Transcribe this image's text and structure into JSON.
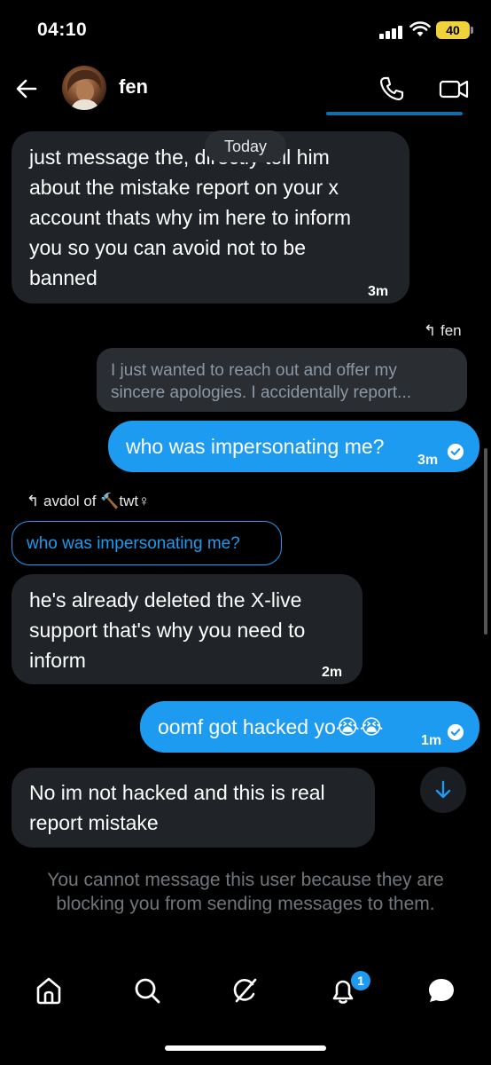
{
  "status_bar": {
    "time": "04:10",
    "battery": "40"
  },
  "header": {
    "contact_name": "fen",
    "back_icon": "arrow-left-icon",
    "call_icon": "phone-icon",
    "video_icon": "video-camera-icon"
  },
  "date_divider": "Today",
  "messages": [
    {
      "direction": "in",
      "lines": [
        "just message the, directly tell him",
        "about the mistake report on your x",
        "account thats why im here to inform",
        "you so you can avoid not to be",
        "banned"
      ],
      "time": "3m"
    },
    {
      "direction": "out",
      "reply_to_label": "fen",
      "quoted_lines": [
        "I just wanted to reach out and offer my",
        "sincere apologies. I accidentally report..."
      ],
      "text": "who was impersonating me?",
      "time": "3m",
      "read": true
    },
    {
      "direction": "in",
      "reply_to_label": "avdol of 🔨twt♀",
      "quoted_text": "who was impersonating me?",
      "lines": [
        "he's already deleted the X-live",
        "support that's why you need to",
        "inform"
      ],
      "time": "2m"
    },
    {
      "direction": "out",
      "text": "oomf got hacked yo😭😭",
      "time": "1m",
      "read": true
    },
    {
      "direction": "in",
      "lines": [
        "No im not hacked and this is real",
        "report mistake"
      ]
    }
  ],
  "blocked_notice": "You cannot message this user because they are blocking you from sending messages to them.",
  "bottom_nav": {
    "items": [
      "home-icon",
      "search-icon",
      "grok-icon",
      "bell-icon",
      "messages-icon"
    ],
    "notification_count": "1"
  },
  "colors": {
    "accent": "#1d9bf0",
    "incoming_bubble": "#202327",
    "background": "#000000"
  }
}
